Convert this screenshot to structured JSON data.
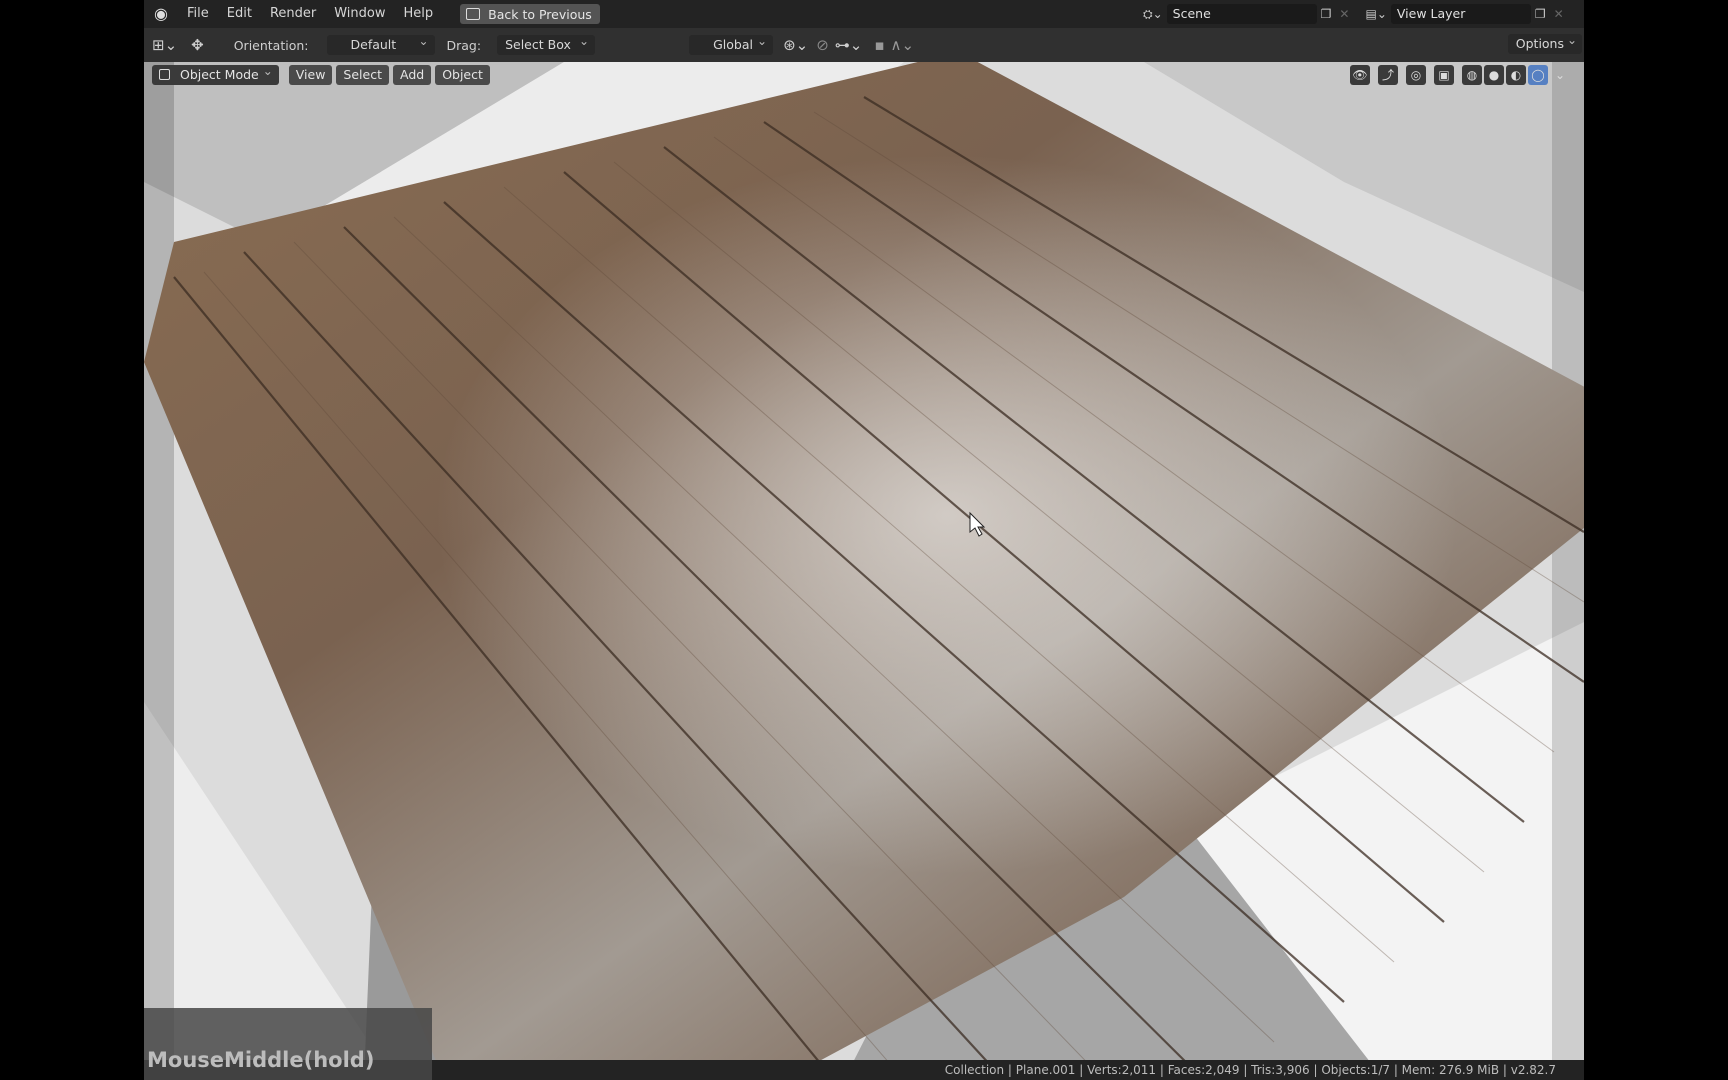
{
  "topbar": {
    "menus": [
      "File",
      "Edit",
      "Render",
      "Window",
      "Help"
    ],
    "back_button": "Back to Previous",
    "scene": "Scene",
    "view_layer": "View Layer"
  },
  "header": {
    "orientation_label": "Orientation:",
    "orientation_value": "Default",
    "drag_label": "Drag:",
    "drag_value": "Select Box",
    "transform_space": "Global",
    "options": "Options"
  },
  "viewport": {
    "mode": "Object Mode",
    "buttons": [
      "View",
      "Select",
      "Add",
      "Object"
    ],
    "shading_icons": [
      "visibility-icon",
      "gizmo-icon",
      "overlay-icon",
      "xray-icon",
      "wireframe-icon",
      "solid-icon",
      "material-icon",
      "rendered-icon"
    ]
  },
  "hint": "MouseMiddle(hold)",
  "status": "Collection | Plane.001 | Verts:2,011 | Faces:2,049 | Tris:3,906 | Objects:1/7 | Mem: 276.9 MiB | v2.82.7"
}
